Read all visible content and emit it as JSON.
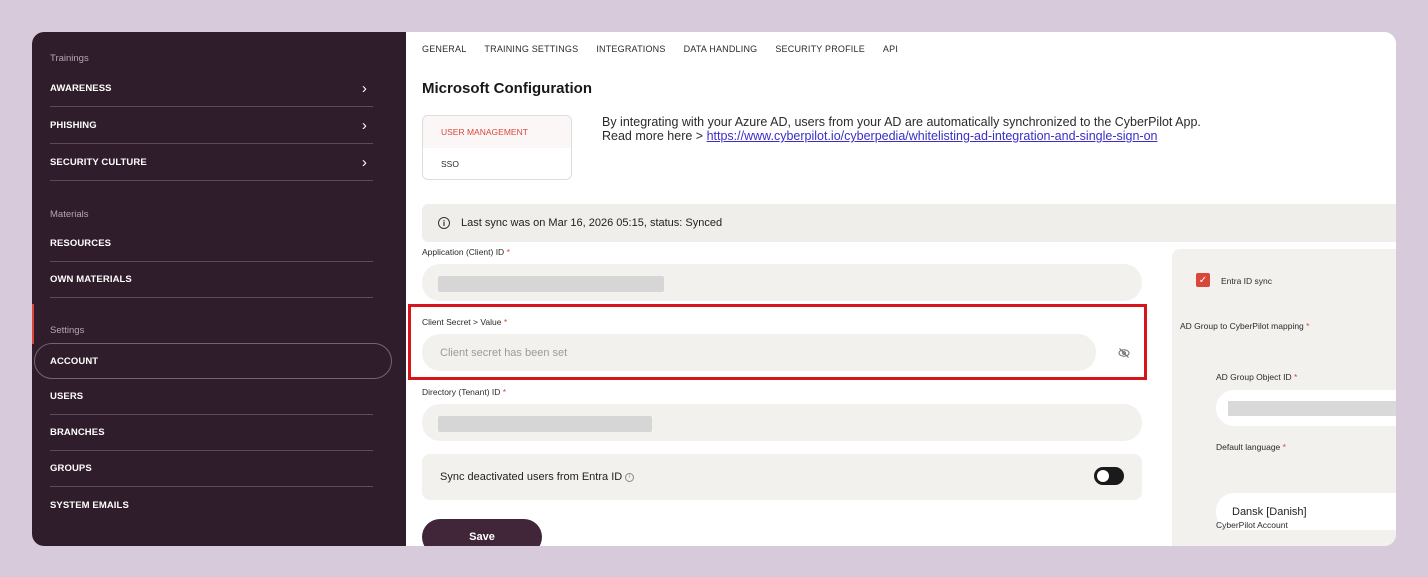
{
  "sidebar": {
    "sections": {
      "trainings": "Trainings",
      "materials": "Materials",
      "settings": "Settings"
    },
    "trainings_items": [
      "AWARENESS",
      "PHISHING",
      "SECURITY CULTURE"
    ],
    "materials_items": [
      "RESOURCES",
      "OWN MATERIALS"
    ],
    "settings_items": [
      "ACCOUNT",
      "USERS",
      "BRANCHES",
      "GROUPS",
      "SYSTEM EMAILS"
    ],
    "active_item": "ACCOUNT",
    "chevron": "›"
  },
  "tabs": [
    "GENERAL",
    "TRAINING SETTINGS",
    "INTEGRATIONS",
    "DATA HANDLING",
    "SECURITY PROFILE",
    "API"
  ],
  "page_title": "Microsoft Configuration",
  "subtabs": {
    "active": "USER MANAGEMENT",
    "inactive": "SSO"
  },
  "intro": {
    "line1": "By integrating with your Azure AD, users from your AD are automatically synchronized to the CyberPilot App.",
    "line2_prefix": "Read more here > ",
    "link": "https://www.cyberpilot.io/cyberpedia/whitelisting-ad-integration-and-single-sign-on"
  },
  "sync_status": "Last sync was on Mar 16, 2026 05:15, status: Synced",
  "fields": {
    "client_id_label": "Application (Client) ID",
    "client_secret_label": "Client Secret > Value",
    "client_secret_placeholder": "Client secret has been set",
    "tenant_id_label": "Directory (Tenant) ID",
    "required_mark": "*"
  },
  "sync_deactivated": {
    "label": "Sync deactivated users from Entra ID",
    "enabled": true
  },
  "save_label": "Save",
  "right_panel": {
    "entra_sync_label": "Entra ID sync",
    "entra_sync_checked": true,
    "mapping_label": "AD Group to CyberPilot mapping",
    "group_object_id_label": "AD Group Object ID",
    "default_language_label": "Default language",
    "default_language_value": "Dansk [Danish]",
    "cyberpilot_account_label": "CyberPilot Account"
  },
  "colors": {
    "sidebar_bg": "#2f1d2b",
    "accent": "#d9473b",
    "highlight_box": "#d8141b",
    "save_button": "#402638",
    "link": "#3a2ec7"
  },
  "icons": {
    "info": "i",
    "check": "✓"
  }
}
